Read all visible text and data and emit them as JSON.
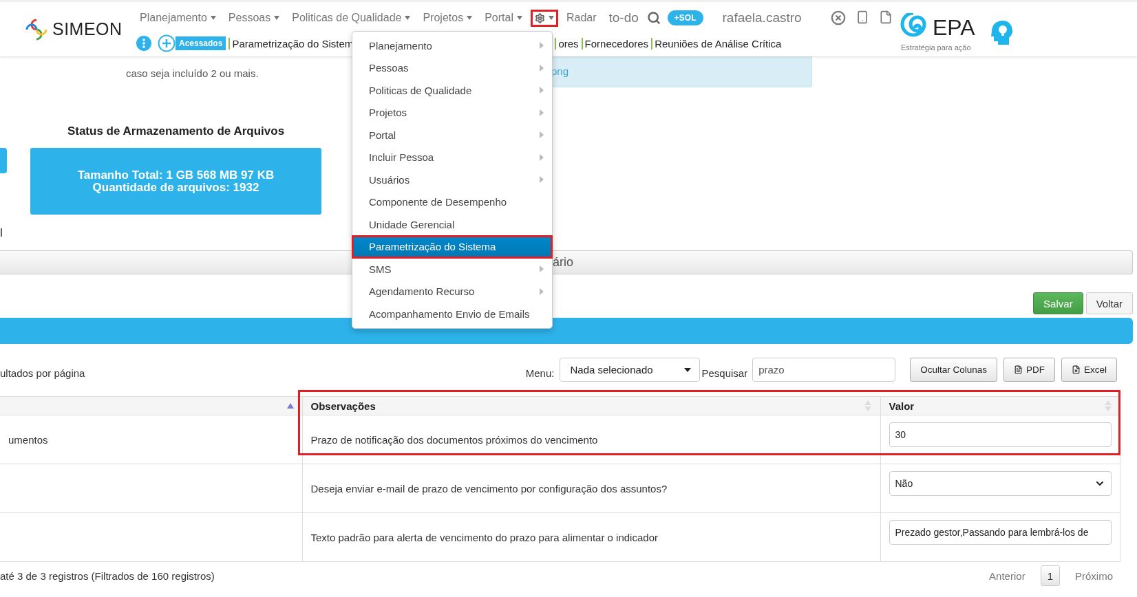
{
  "header": {
    "brand": "SIMEON",
    "nav": [
      {
        "kind": "dropdown",
        "label": "Planejamento"
      },
      {
        "kind": "dropdown",
        "label": "Pessoas"
      },
      {
        "kind": "dropdown",
        "label": "Politicas de Qualidade"
      },
      {
        "kind": "dropdown",
        "label": "Projetos"
      },
      {
        "kind": "dropdown",
        "label": "Portal"
      },
      {
        "kind": "gear",
        "expanded": true,
        "outlined": true
      },
      {
        "kind": "link",
        "label": "Radar"
      },
      {
        "kind": "big",
        "label": "to-do"
      },
      {
        "kind": "search"
      },
      {
        "kind": "pill",
        "label": "+SOL"
      },
      {
        "kind": "user",
        "label": "rafaela.castro"
      }
    ],
    "accessed_label": "Acessados",
    "accessed_links": [
      "Parametrização do Sistem",
      "ores",
      "Fornecedores",
      "Reuniões de Análise Crítica"
    ],
    "partner": {
      "name": "EPA",
      "tagline": "Estratégia para ação"
    }
  },
  "settings_menu": [
    {
      "label": "Planejamento",
      "submenu": true,
      "selected": false,
      "outlined": false
    },
    {
      "label": "Pessoas",
      "submenu": true,
      "selected": false,
      "outlined": false
    },
    {
      "label": "Politicas de Qualidade",
      "submenu": true,
      "selected": false,
      "outlined": false
    },
    {
      "label": "Projetos",
      "submenu": true,
      "selected": false,
      "outlined": false
    },
    {
      "label": "Portal",
      "submenu": true,
      "selected": false,
      "outlined": false
    },
    {
      "label": "Incluir Pessoa",
      "submenu": true,
      "selected": false,
      "outlined": false
    },
    {
      "label": "Usuários",
      "submenu": true,
      "selected": false,
      "outlined": false
    },
    {
      "label": "Componente de Desempenho",
      "submenu": false,
      "selected": false,
      "outlined": false
    },
    {
      "label": "Unidade Gerencial",
      "submenu": false,
      "selected": false,
      "outlined": false
    },
    {
      "label": "Parametrização do Sistema",
      "submenu": false,
      "selected": true,
      "outlined": true
    },
    {
      "label": "SMS",
      "submenu": true,
      "selected": false,
      "outlined": false
    },
    {
      "label": "Agendamento Recurso",
      "submenu": true,
      "selected": false,
      "outlined": false
    },
    {
      "label": "Acompanhamento Envio de Emails",
      "submenu": false,
      "selected": false,
      "outlined": false
    }
  ],
  "ip_note": "caso seja incluído 2 ou mais.",
  "image_note": "png",
  "storage": {
    "title": "Status de Armazenamento de Arquivos",
    "lines": [
      "Tamanho Total: 1 GB 568 MB 97 KB",
      "Quantidade de arquivos: 1932"
    ]
  },
  "cut_label": "l",
  "section_title": "ário",
  "actions": [
    {
      "label": "Salvar",
      "kind": "primary"
    },
    {
      "label": "Voltar",
      "kind": "default"
    }
  ],
  "page_size_label": "ultados por página",
  "menu_filter": {
    "label": "Menu:",
    "value": "Nada selecionado"
  },
  "search": {
    "label": "Pesquisar",
    "value": "prazo"
  },
  "export_buttons": [
    {
      "label": "Ocultar Colunas",
      "kind": "plain"
    },
    {
      "label": "PDF",
      "kind": "pdf"
    },
    {
      "label": "Excel",
      "kind": "excel"
    }
  ],
  "table": {
    "columns": [
      {
        "sorted": true
      },
      {
        "label": "Observações",
        "sorted": false
      },
      {
        "label": "Valor",
        "sorted": false
      }
    ],
    "rows": [
      {
        "column_1": "umentos",
        "observation": "Prazo de notificação dos documentos próximos do vencimento",
        "value": {
          "kind": "input",
          "text": "30"
        },
        "outlined": true
      },
      {
        "observation": "Deseja enviar e-mail de prazo de vencimento por configuração dos assuntos?",
        "value": {
          "kind": "select",
          "text": "Não"
        },
        "outlined": false
      },
      {
        "observation": "Texto padrão para alerta de vencimento do prazo para alimentar o indicador",
        "value": {
          "kind": "input",
          "text": "Prezado gestor,Passando para lembrá-los de"
        },
        "outlined": false
      }
    ]
  },
  "footer": {
    "summary": "até 3 de 3 registros (Filtrados de 160 registros)",
    "pagination": [
      {
        "label": "Anterior",
        "selected": false
      },
      {
        "label": "1",
        "selected": true
      },
      {
        "label": "Próximo",
        "selected": false
      }
    ]
  }
}
